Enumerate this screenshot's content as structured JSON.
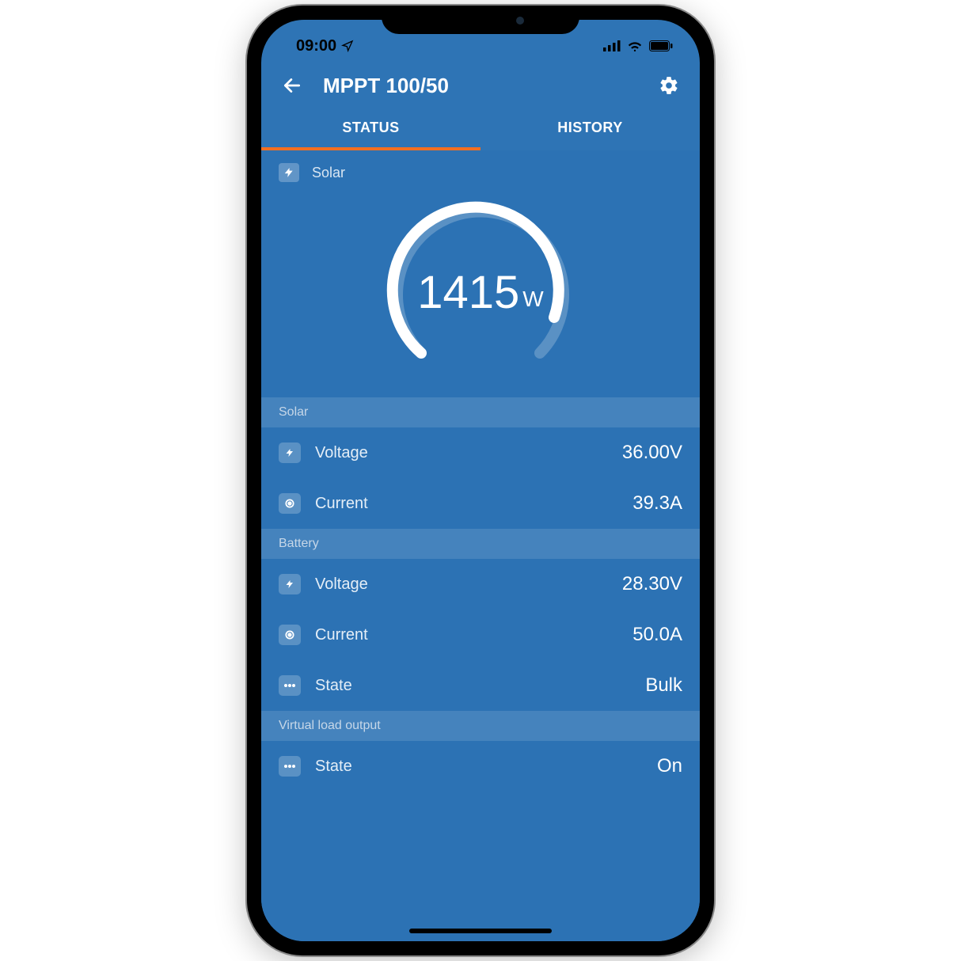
{
  "statusbar": {
    "time": "09:00"
  },
  "header": {
    "title": "MPPT 100/50"
  },
  "tabs": {
    "status": "STATUS",
    "history": "HISTORY"
  },
  "gauge": {
    "label": "Solar",
    "value": "1415",
    "unit": "W"
  },
  "solar": {
    "heading": "Solar",
    "voltage_label": "Voltage",
    "voltage_value": "36.00V",
    "current_label": "Current",
    "current_value": "39.3A"
  },
  "battery": {
    "heading": "Battery",
    "voltage_label": "Voltage",
    "voltage_value": "28.30V",
    "current_label": "Current",
    "current_value": "50.0A",
    "state_label": "State",
    "state_value": "Bulk"
  },
  "load": {
    "heading": "Virtual load output",
    "state_label": "State",
    "state_value": "On"
  }
}
